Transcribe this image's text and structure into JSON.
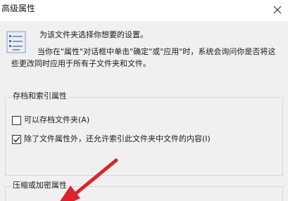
{
  "window": {
    "title": "高级属性"
  },
  "description": {
    "line1": "为该文件夹选择你想要的设置。",
    "line2": "当你在\"属性\"对话框中单击\"确定\"或\"应用\"时，系统会询问你是否将这",
    "line3": "些更改同时应用于所有子文件夹和文件。"
  },
  "archive_group": {
    "title": "存档和索引属性",
    "options": [
      {
        "label": "可以存档文件夹(A)",
        "checked": false
      },
      {
        "label": "除了文件属性外，还允许索引此文件夹中文件的内容(I)",
        "checked": true
      }
    ]
  },
  "compress_group": {
    "title": "压缩或加密属性"
  },
  "colors": {
    "annotation_arrow": "#d9242b",
    "group_border": "#d7d7d7",
    "background": "#f0f0f0"
  },
  "icons": {
    "close": "close-icon",
    "folder": "folder-properties-icon",
    "checkmark": "checkmark-icon"
  }
}
